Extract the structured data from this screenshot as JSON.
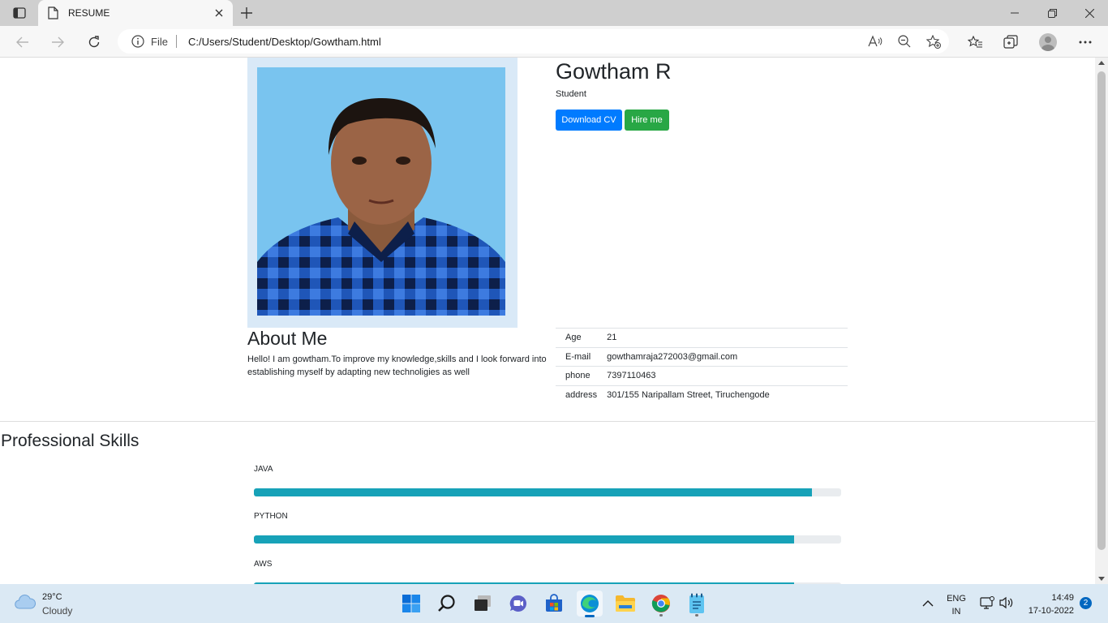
{
  "browser": {
    "tab_title": "RESUME",
    "address_scheme": "File",
    "address_url": "C:/Users/Student/Desktop/Gowtham.html"
  },
  "profile": {
    "name": "Gowtham R",
    "role": "Student",
    "download_cv_label": "Download CV",
    "hire_me_label": "Hire me",
    "button_colors": {
      "download_cv": "#007bff",
      "hire_me": "#28a745"
    }
  },
  "about": {
    "title": "About Me",
    "text": "Hello! I am gowtham.To improve my knowledge,skills and I look forward into establishing myself by adapting new technoligies as well"
  },
  "details": [
    {
      "label": "Age",
      "value": "21"
    },
    {
      "label": "E-mail",
      "value": "gowthamraja272003@gmail.com"
    },
    {
      "label": "phone",
      "value": "7397110463"
    },
    {
      "label": "address",
      "value": "301/155 Naripallam Street, Tiruchengode"
    }
  ],
  "skills": {
    "title": "Professional Skills",
    "bar_color": "#17a2b8",
    "items": [
      {
        "label": "JAVA",
        "level": 0.95
      },
      {
        "label": "PYTHON",
        "level": 0.92
      },
      {
        "label": "AWS",
        "level": 0.92
      }
    ]
  },
  "taskbar": {
    "temperature": "29°C",
    "condition": "Cloudy",
    "language": "ENG",
    "region": "IN",
    "time": "14:49",
    "date": "17-10-2022",
    "notification_count": "2"
  }
}
